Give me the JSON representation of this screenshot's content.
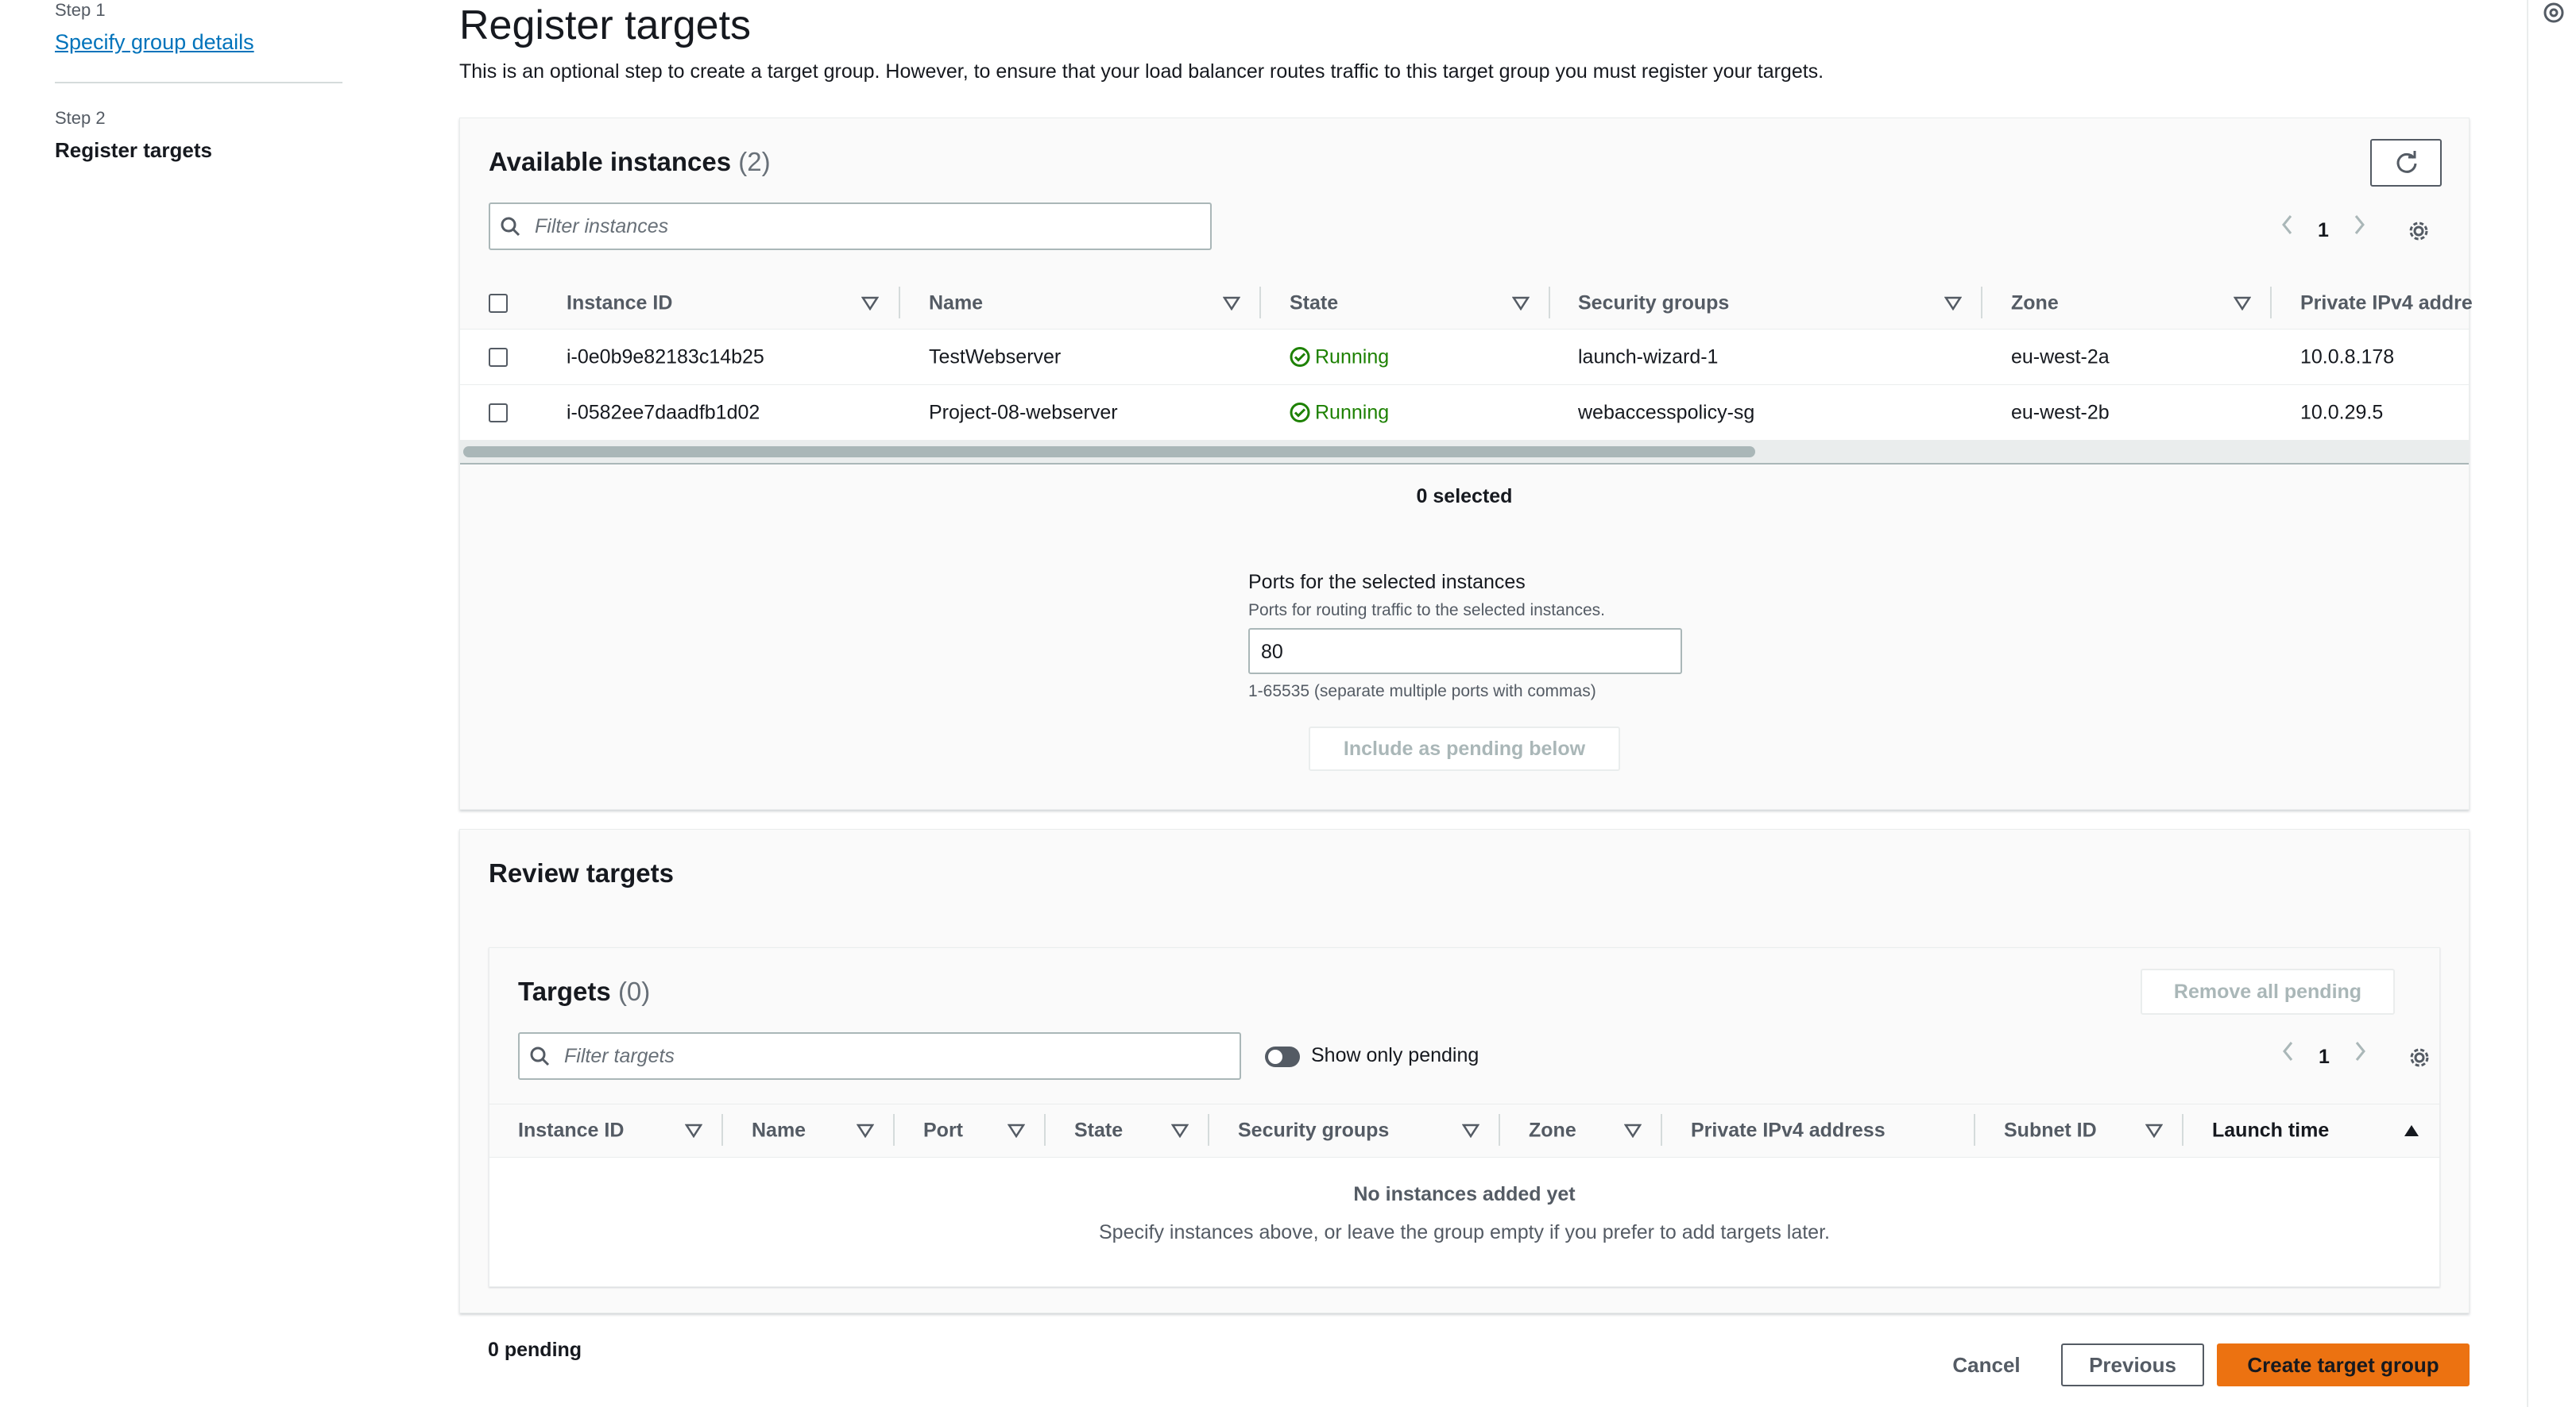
{
  "nav": {
    "step1_label": "Step 1",
    "step1_link": "Specify group details",
    "step2_label": "Step 2",
    "step2_title": "Register targets"
  },
  "header": {
    "title": "Register targets",
    "description": "This is an optional step to create a target group. However, to ensure that your load balancer routes traffic to this target group you must register your targets."
  },
  "available": {
    "title": "Available instances",
    "count": "(2)",
    "filter_placeholder": "Filter instances",
    "page": "1",
    "columns": [
      "Instance ID",
      "Name",
      "State",
      "Security groups",
      "Zone",
      "Private IPv4 addre"
    ],
    "rows": [
      {
        "id": "i-0e0b9e82183c14b25",
        "name": "TestWebserver",
        "state": "Running",
        "sg": "launch-wizard-1",
        "zone": "eu-west-2a",
        "ip": "10.0.8.178"
      },
      {
        "id": "i-0582ee7daadfb1d02",
        "name": "Project-08-webserver",
        "state": "Running",
        "sg": "webaccesspolicy-sg",
        "zone": "eu-west-2b",
        "ip": "10.0.29.5"
      }
    ],
    "selected": "0 selected",
    "ports_label": "Ports for the selected instances",
    "ports_desc": "Ports for routing traffic to the selected instances.",
    "ports_value": "80",
    "ports_hint": "1-65535 (separate multiple ports with commas)",
    "include_button": "Include as pending below"
  },
  "review": {
    "title": "Review targets",
    "targets_title": "Targets",
    "targets_count": "(0)",
    "remove_all": "Remove all pending",
    "filter_placeholder": "Filter targets",
    "toggle_label": "Show only pending",
    "page": "1",
    "columns": [
      "Instance ID",
      "Name",
      "Port",
      "State",
      "Security groups",
      "Zone",
      "Private IPv4 address",
      "Subnet ID",
      "Launch time"
    ],
    "empty_title": "No instances added yet",
    "empty_desc": "Specify instances above, or leave the group empty if you prefer to add targets later."
  },
  "footer": {
    "pending": "0 pending",
    "cancel": "Cancel",
    "previous": "Previous",
    "create": "Create target group"
  },
  "colors": {
    "primary": "#ec7211",
    "link": "#0073bb",
    "success": "#1d8102"
  }
}
